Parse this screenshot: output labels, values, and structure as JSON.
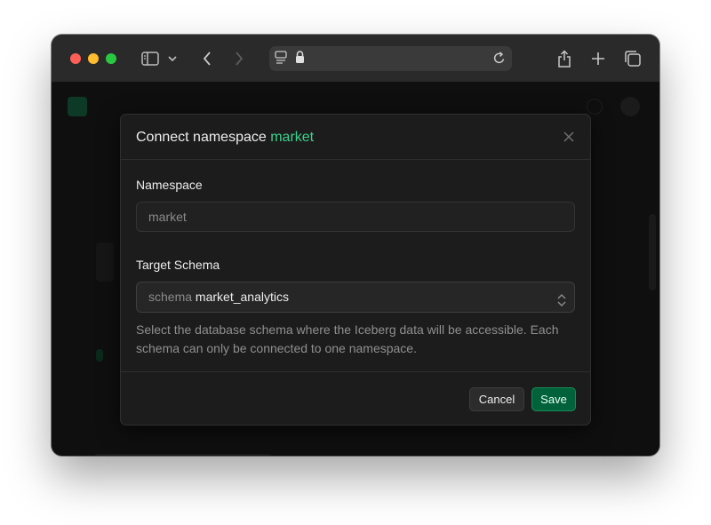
{
  "browser": {
    "icons": [
      "sidebar-icon",
      "chevron-down-icon",
      "back-icon",
      "forward-icon",
      "page-icon",
      "lock-icon",
      "reload-icon",
      "share-icon",
      "new-tab-icon",
      "tabs-icon"
    ]
  },
  "dialog": {
    "title": "Connect namespace",
    "title_accent": "market",
    "namespace_label": "Namespace",
    "namespace_value": "market",
    "schema_label": "Target Schema",
    "schema_prefix": "schema",
    "schema_value": "market_analytics",
    "help_text": "Select the database schema where the Iceberg data will be accessible. Each schema can only be connected to one namespace.",
    "cancel_label": "Cancel",
    "save_label": "Save"
  },
  "colors": {
    "accent": "#3ecf8e",
    "save_bg": "#00623a",
    "modal_bg": "#1c1c1c"
  }
}
